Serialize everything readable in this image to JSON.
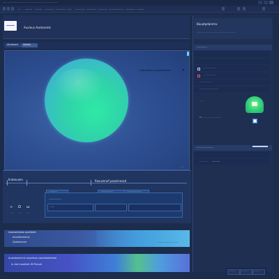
{
  "titlebar": {
    "title": "—— ——————— ——— ——————— ——————",
    "menu": [
      "—",
      "———",
      "———",
      "————",
      "————",
      "——",
      "————",
      "————",
      "————",
      "——————",
      "————",
      "———"
    ]
  },
  "app": {
    "title": "Auxious   Asutsesmk",
    "tabs": [
      "Aluexsen",
      "Vazies"
    ]
  },
  "canvas": {
    "caption": "Abauksten   Ausktsemeis"
  },
  "properties": {
    "left_label": "Ilutexuxen",
    "left_value": "——",
    "center_title": "Rasuzenef   poukmeasd",
    "subtabs": [
      "————",
      "——————",
      "———————"
    ],
    "row_label": "——————",
    "row2_label": "——",
    "left_controls": [
      "∞",
      "Ω",
      "ω"
    ],
    "left_numbers": [
      "——",
      "——",
      "——"
    ]
  },
  "bar1": {
    "title": "Aosewetstwo   apolteeb",
    "line1": "Ausoleeneanux",
    "line2": "Sulotmeusre",
    "right_text": "——— ———— ——"
  },
  "bar2": {
    "line1": "Ausotoxemnix   aupolous   yoouloxbeiveal",
    "line2": "In   dot   mastlnet   IN   Poluuh"
  },
  "right_panel": {
    "header_title": "Bauotpdaremx",
    "header_sub": "———— ——————— ———————",
    "section1": "—————",
    "rows": [
      "——————",
      "——————",
      "——————",
      "————",
      "——————"
    ],
    "row_label_a": "———— —————",
    "row_label_b": "——",
    "row_label_c": "Pr——— ——————",
    "section2": "————————",
    "row_label_d": "————",
    "row_label_e": "————",
    "bottom_buttons": [
      "———",
      "———",
      "———"
    ]
  }
}
